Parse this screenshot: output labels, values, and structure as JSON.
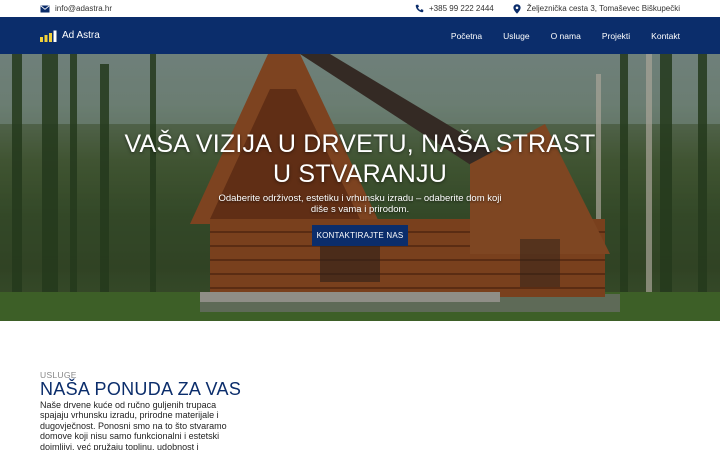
{
  "topbar": {
    "email": "info@adastra.hr",
    "phone": "+385 99 222 2444",
    "address": "Željeznička cesta 3, Tomaševec Biškupečki",
    "icons": {
      "email": "envelope-icon",
      "phone": "phone-icon",
      "address": "map-pin-icon"
    }
  },
  "nav": {
    "brand": "Ad Astra",
    "items": [
      {
        "label": "Početna"
      },
      {
        "label": "Usluge"
      },
      {
        "label": "O nama"
      },
      {
        "label": "Projekti"
      },
      {
        "label": "Kontakt"
      }
    ]
  },
  "hero": {
    "title": "VAŠA VIZIJA U DRVETU, NAŠA STRAST U STVARANJU",
    "subtitle": "Odaberite održivost, estetiku i vrhunsku izradu – odaberite dom koji diše s vama i prirodom.",
    "button": "KONTAKTIRAJTE NAS"
  },
  "services": {
    "eyebrow": "USLUGE",
    "title": "NAŠA PONUDA ZA VAS",
    "text": "Naše drvene kuće od ručno guljenih trupaca spajaju vrhunsku izradu, prirodne materijale i dugovječnost. Ponosni smo na to što stvaramo domove koji nisu samo funkcionalni i estetski dojmljivi, već pružaju toplinu, udobnost i"
  },
  "colors": {
    "brand": "#0b2d6b",
    "logo_accent": "#f2d13a"
  }
}
